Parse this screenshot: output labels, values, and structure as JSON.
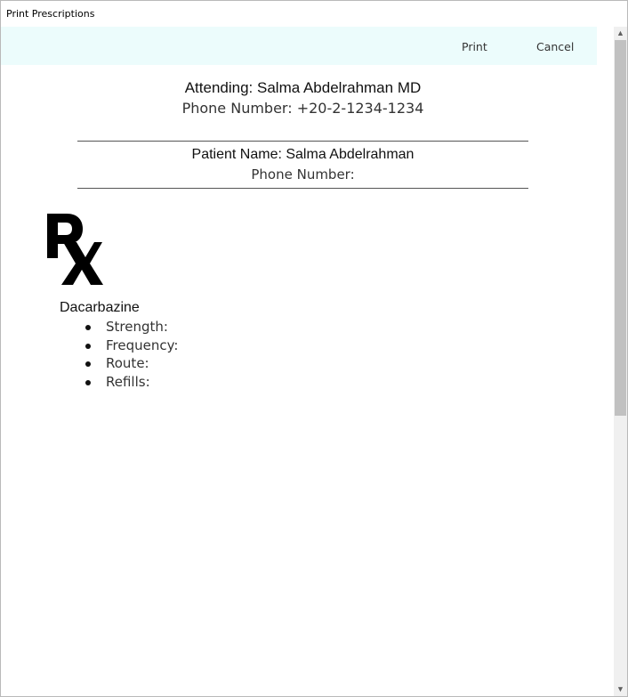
{
  "window": {
    "title": "Print Prescriptions"
  },
  "toolbar": {
    "print_label": "Print",
    "cancel_label": "Cancel"
  },
  "attending": {
    "line": "Attending: Salma Abdelrahman MD",
    "phone_line": "Phone Number: +20-2-1234-1234"
  },
  "patient": {
    "line": "Patient Name: Salma Abdelrahman",
    "phone_line": "Phone Number:"
  },
  "prescription": {
    "rx_symbol": "Rx",
    "drug_name": "Dacarbazine",
    "details": [
      {
        "label": "Strength:"
      },
      {
        "label": "Frequency:"
      },
      {
        "label": "Route:"
      },
      {
        "label": "Refills:"
      }
    ]
  },
  "icons": {
    "scroll_up": "scroll-up-arrow-icon",
    "scroll_down": "scroll-down-arrow-icon"
  }
}
